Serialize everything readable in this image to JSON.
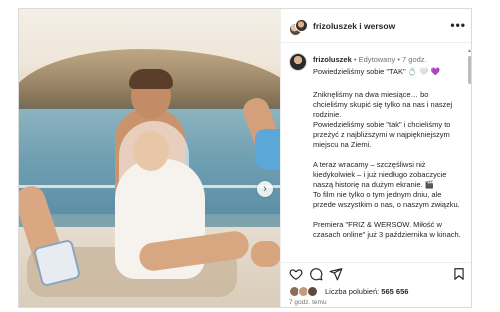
{
  "header": {
    "title": "frizoluszek i wersow",
    "more_icon": "more-horizontal-icon"
  },
  "caption": {
    "username": "frizoluszek",
    "separator": " • ",
    "edited": "Edytowany",
    "time": " • 7 godz.",
    "first_line": "Powiedzieliśmy sobie \"TAK\" 💍 🤍 💜",
    "paragraphs": [
      "Zniknęliśmy na dwa miesiące… bo chcieliśmy skupić się tylko na nas i naszej rodzinie.\nPowiedzieliśmy sobie \"tak\" i chcieliśmy to przeżyć z najbliższymi w najpiękniejszym miejscu na Ziemi.",
      "A teraz wracamy – szczęśliwsi niż kiedykolwiek – i już niedługo zobaczycie naszą historię na dużym ekranie. 🎬\nTo film nie tylko o tym jednym dniu, ale przede wszystkim o nas, o naszym związku.",
      "Premiera \"FRIZ & WERSOW. Miłość w czasach online\" już 3 października w kinach."
    ]
  },
  "actions": {
    "like_icon": "heart-icon",
    "comment_icon": "comment-icon",
    "share_icon": "share-icon",
    "save_icon": "bookmark-icon"
  },
  "likes": {
    "label": "Liczba polubień: ",
    "count": "565 656"
  },
  "timestamp": "7 godz. temu",
  "photo": {
    "next_icon": "chevron-right-icon",
    "next_glyph": "›"
  }
}
